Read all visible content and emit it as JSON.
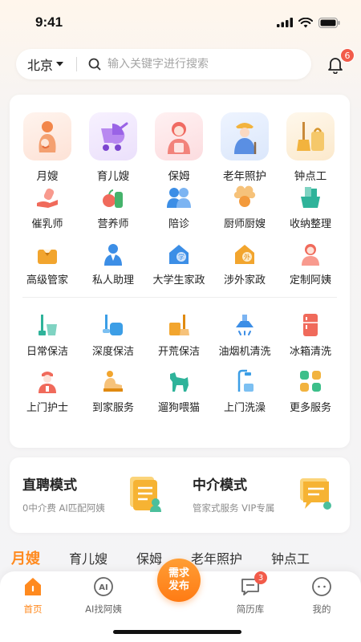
{
  "status": {
    "time": "9:41"
  },
  "header": {
    "city": "北京",
    "search_placeholder": "输入关键字进行搜索",
    "notification_count": "6"
  },
  "services": {
    "featured": [
      {
        "label": "月嫂",
        "icon": "mother-baby-icon",
        "bg": "#fde9df"
      },
      {
        "label": "育儿嫂",
        "icon": "stroller-icon",
        "bg": "#efe6fb"
      },
      {
        "label": "保姆",
        "icon": "nanny-icon",
        "bg": "#fde4e6"
      },
      {
        "label": "老年照护",
        "icon": "elderly-icon",
        "bg": "#e3edfb"
      },
      {
        "label": "钟点工",
        "icon": "broom-bag-icon",
        "bg": "#fdf0dc"
      }
    ],
    "secondary": [
      {
        "label": "催乳师",
        "icon": "hand-bottle-icon",
        "color": "#f06a5b"
      },
      {
        "label": "营养师",
        "icon": "nutrition-icon",
        "color": "#45b36b"
      },
      {
        "label": "陪诊",
        "icon": "companion-icon",
        "color": "#3c8ee6"
      },
      {
        "label": "厨师厨嫂",
        "icon": "chef-icon",
        "color": "#f39a3c"
      },
      {
        "label": "收纳整理",
        "icon": "storage-basket-icon",
        "color": "#2fb39a"
      },
      {
        "label": "高级管家",
        "icon": "butler-icon",
        "color": "#f2a52e"
      },
      {
        "label": "私人助理",
        "icon": "assistant-icon",
        "color": "#3c8ee6"
      },
      {
        "label": "大学生家政",
        "icon": "student-house-icon",
        "color": "#3c8ee6"
      },
      {
        "label": "涉外家政",
        "icon": "foreign-house-icon",
        "color": "#f2a52e"
      },
      {
        "label": "定制阿姨",
        "icon": "custom-auntie-icon",
        "color": "#f06a5b"
      }
    ],
    "cleaning": [
      {
        "label": "日常保洁",
        "icon": "mop-bucket-icon",
        "color": "#2fb39a"
      },
      {
        "label": "深度保洁",
        "icon": "vacuum-icon",
        "color": "#3c9ee6"
      },
      {
        "label": "开荒保洁",
        "icon": "cleaning-kit-icon",
        "color": "#f2a52e"
      },
      {
        "label": "油烟机清洗",
        "icon": "range-hood-icon",
        "color": "#3c8ee6"
      },
      {
        "label": "冰箱清洗",
        "icon": "fridge-icon",
        "color": "#f06a5b"
      },
      {
        "label": "上门护士",
        "icon": "nurse-icon",
        "color": "#f06a5b"
      },
      {
        "label": "到家服务",
        "icon": "home-service-icon",
        "color": "#f2a52e"
      },
      {
        "label": "遛狗喂猫",
        "icon": "dog-icon",
        "color": "#2fb39a"
      },
      {
        "label": "上门洗澡",
        "icon": "shower-icon",
        "color": "#3c9ee6"
      },
      {
        "label": "更多服务",
        "icon": "more-grid-icon",
        "color": "#3cbf8a"
      }
    ]
  },
  "modes": [
    {
      "title": "直聘模式",
      "subtitle": "0中介费 AI匹配阿姨",
      "icon": "document-person-icon"
    },
    {
      "title": "中介模式",
      "subtitle": "管家式服务 VIP专属",
      "icon": "chat-document-icon"
    }
  ],
  "category_tabs": [
    "月嫂",
    "育儿嫂",
    "保姆",
    "老年照护",
    "钟点工"
  ],
  "bottom_nav": {
    "home": "首页",
    "ai_find": "AI找阿姨",
    "publish_line1": "需求",
    "publish_line2": "发布",
    "resume": "简历库",
    "resume_count": "3",
    "mine": "我的"
  },
  "colors": {
    "accent": "#ff8a1f",
    "badge": "#f25b4a"
  }
}
